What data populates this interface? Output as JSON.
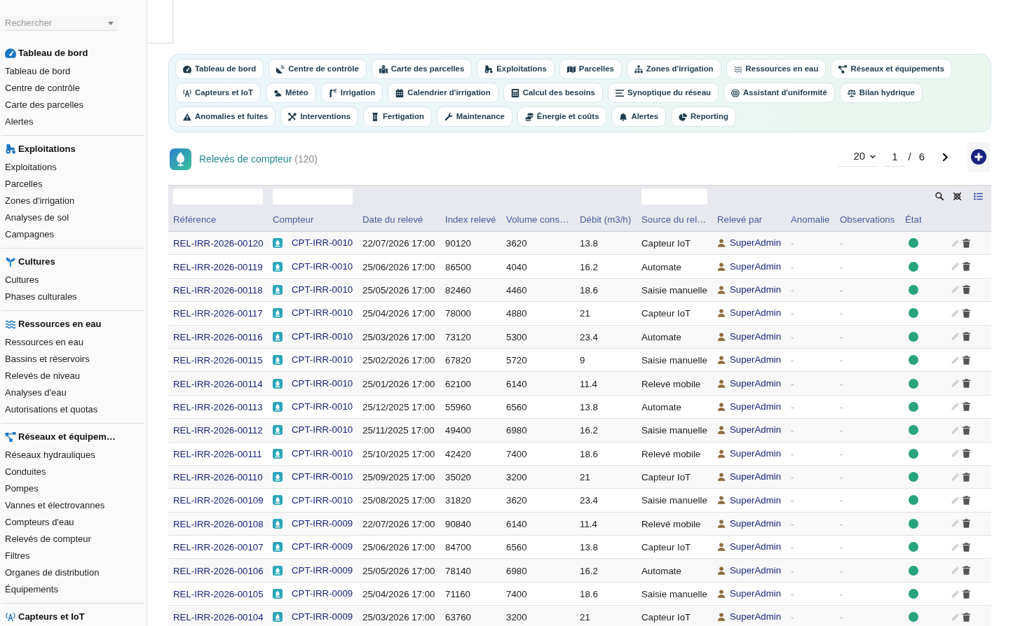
{
  "sidebar": {
    "search": {
      "placeholder": "Rechercher"
    },
    "sections": [
      {
        "title": "Tableau de bord",
        "items": [
          {
            "label": "Tableau de bord"
          },
          {
            "label": "Centre de contrôle"
          },
          {
            "label": "Carte des parcelles"
          },
          {
            "label": "Alertes"
          }
        ]
      },
      {
        "title": "Exploitations",
        "items": [
          {
            "label": "Exploitations"
          },
          {
            "label": "Parcelles"
          },
          {
            "label": "Zones d'irrigation"
          },
          {
            "label": "Analyses de sol"
          },
          {
            "label": "Campagnes"
          }
        ]
      },
      {
        "title": "Cultures",
        "items": [
          {
            "label": "Cultures"
          },
          {
            "label": "Phases culturales"
          }
        ]
      },
      {
        "title": "Ressources en eau",
        "items": [
          {
            "label": "Ressources en eau"
          },
          {
            "label": "Bassins et réservoirs"
          },
          {
            "label": "Relevés de niveau"
          },
          {
            "label": "Analyses d'eau"
          },
          {
            "label": "Autorisations et quotas"
          }
        ]
      },
      {
        "title": "Réseaux et équipem…",
        "items": [
          {
            "label": "Réseaux hydrauliques"
          },
          {
            "label": "Conduites"
          },
          {
            "label": "Pompes"
          },
          {
            "label": "Vannes et électrovannes"
          },
          {
            "label": "Compteurs d'eau"
          },
          {
            "label": "Relevés de compteur"
          },
          {
            "label": "Filtres"
          },
          {
            "label": "Organes de distribution"
          },
          {
            "label": "Équipements"
          }
        ]
      },
      {
        "title": "Capteurs et IoT"
      }
    ]
  },
  "quick_links": {
    "rows": [
      [
        {
          "label": "Tableau de bord"
        },
        {
          "label": "Centre de contrôle"
        },
        {
          "label": "Carte des parcelles"
        },
        {
          "label": "Exploitations"
        },
        {
          "label": "Parcelles"
        },
        {
          "label": "Zones d'irrigation"
        },
        {
          "label": "Ressources en eau"
        },
        {
          "label": "Réseaux et équipements"
        }
      ],
      [
        {
          "label": "Capteurs et IoT"
        },
        {
          "label": "Météo"
        },
        {
          "label": "Irrigation"
        },
        {
          "label": "Calendrier d'irrigation"
        },
        {
          "label": "Calcul des besoins"
        },
        {
          "label": "Synoptique du réseau"
        },
        {
          "label": "Assistant d'uniformité"
        },
        {
          "label": "Bilan hydrique"
        }
      ],
      [
        {
          "label": "Anomalies et fuites"
        },
        {
          "label": "Interventions"
        },
        {
          "label": "Fertigation"
        },
        {
          "label": "Maintenance"
        },
        {
          "label": "Énergie et coûts"
        },
        {
          "label": "Alertes"
        },
        {
          "label": "Reporting"
        }
      ]
    ]
  },
  "list": {
    "title": "Relevés de compteur",
    "count": "(120)",
    "pagination": {
      "page_size": "20",
      "page": "1",
      "separator": "/",
      "total_pages": "6"
    }
  },
  "table": {
    "columns": [
      {
        "label": "Référence",
        "filterable": true
      },
      {
        "label": "Compteur",
        "filterable": true
      },
      {
        "label": "Date du relevé",
        "filterable": false
      },
      {
        "label": "Index relevé",
        "filterable": false
      },
      {
        "label": "Volume cons…",
        "filterable": false
      },
      {
        "label": "Débit (m3/h)",
        "filterable": false
      },
      {
        "label": "Source du rel…",
        "filterable": true
      },
      {
        "label": "Relevé par",
        "filterable": false
      },
      {
        "label": "Anomalie",
        "filterable": false
      },
      {
        "label": "Observations",
        "filterable": false
      },
      {
        "label": "État",
        "filterable": false
      }
    ],
    "rows": [
      {
        "reference": "REL-IRR-2026-00120",
        "meter": "CPT-IRR-0010",
        "date": "22/07/2026 17:00",
        "index": "90120",
        "volume": "3620",
        "flow": "13.8",
        "source": "Capteur IoT",
        "read_by": "SuperAdmin",
        "anomaly": "-",
        "observations": "-",
        "color": "#27a37d"
      },
      {
        "reference": "REL-IRR-2026-00119",
        "meter": "CPT-IRR-0010",
        "date": "25/06/2026 17:00",
        "index": "86500",
        "volume": "4040",
        "flow": "16.2",
        "source": "Automate",
        "read_by": "SuperAdmin",
        "anomaly": "-",
        "observations": "-",
        "color": "#27a37d"
      },
      {
        "reference": "REL-IRR-2026-00118",
        "meter": "CPT-IRR-0010",
        "date": "25/05/2026 17:00",
        "index": "82460",
        "volume": "4460",
        "flow": "18.6",
        "source": "Saisie manuelle",
        "read_by": "SuperAdmin",
        "anomaly": "-",
        "observations": "-",
        "color": "#27a37d"
      },
      {
        "reference": "REL-IRR-2026-00117",
        "meter": "CPT-IRR-0010",
        "date": "25/04/2026 17:00",
        "index": "78000",
        "volume": "4880",
        "flow": "21",
        "source": "Capteur IoT",
        "read_by": "SuperAdmin",
        "anomaly": "-",
        "observations": "-",
        "color": "#27a37d"
      },
      {
        "reference": "REL-IRR-2026-00116",
        "meter": "CPT-IRR-0010",
        "date": "25/03/2026 17:00",
        "index": "73120",
        "volume": "5300",
        "flow": "23.4",
        "source": "Automate",
        "read_by": "SuperAdmin",
        "anomaly": "-",
        "observations": "-",
        "color": "#27a37d"
      },
      {
        "reference": "REL-IRR-2026-00115",
        "meter": "CPT-IRR-0010",
        "date": "25/02/2026 17:00",
        "index": "67820",
        "volume": "5720",
        "flow": "9",
        "source": "Saisie manuelle",
        "read_by": "SuperAdmin",
        "anomaly": "-",
        "observations": "-",
        "color": "#27a37d"
      },
      {
        "reference": "REL-IRR-2026-00114",
        "meter": "CPT-IRR-0010",
        "date": "25/01/2026 17:00",
        "index": "62100",
        "volume": "6140",
        "flow": "11.4",
        "source": "Relevé mobile",
        "read_by": "SuperAdmin",
        "anomaly": "-",
        "observations": "-",
        "color": "#27a37d"
      },
      {
        "reference": "REL-IRR-2026-00113",
        "meter": "CPT-IRR-0010",
        "date": "25/12/2025 17:00",
        "index": "55960",
        "volume": "6560",
        "flow": "13.8",
        "source": "Automate",
        "read_by": "SuperAdmin",
        "anomaly": "-",
        "observations": "-",
        "color": "#27a37d"
      },
      {
        "reference": "REL-IRR-2026-00112",
        "meter": "CPT-IRR-0010",
        "date": "25/11/2025 17:00",
        "index": "49400",
        "volume": "6980",
        "flow": "16.2",
        "source": "Saisie manuelle",
        "read_by": "SuperAdmin",
        "anomaly": "-",
        "observations": "-",
        "color": "#27a37d"
      },
      {
        "reference": "REL-IRR-2026-00111",
        "meter": "CPT-IRR-0010",
        "date": "25/10/2025 17:00",
        "index": "42420",
        "volume": "7400",
        "flow": "18.6",
        "source": "Relevé mobile",
        "read_by": "SuperAdmin",
        "anomaly": "-",
        "observations": "-",
        "color": "#27a37d"
      },
      {
        "reference": "REL-IRR-2026-00110",
        "meter": "CPT-IRR-0010",
        "date": "25/09/2025 17:00",
        "index": "35020",
        "volume": "3200",
        "flow": "21",
        "source": "Capteur IoT",
        "read_by": "SuperAdmin",
        "anomaly": "-",
        "observations": "-",
        "color": "#27a37d"
      },
      {
        "reference": "REL-IRR-2026-00109",
        "meter": "CPT-IRR-0010",
        "date": "25/08/2025 17:00",
        "index": "31820",
        "volume": "3620",
        "flow": "23.4",
        "source": "Saisie manuelle",
        "read_by": "SuperAdmin",
        "anomaly": "-",
        "observations": "-",
        "color": "#27a37d"
      },
      {
        "reference": "REL-IRR-2026-00108",
        "meter": "CPT-IRR-0009",
        "date": "22/07/2026 17:00",
        "index": "90840",
        "volume": "6140",
        "flow": "11.4",
        "source": "Relevé mobile",
        "read_by": "SuperAdmin",
        "anomaly": "-",
        "observations": "-",
        "color": "#27a37d"
      },
      {
        "reference": "REL-IRR-2026-00107",
        "meter": "CPT-IRR-0009",
        "date": "25/06/2026 17:00",
        "index": "84700",
        "volume": "6560",
        "flow": "13.8",
        "source": "Capteur IoT",
        "read_by": "SuperAdmin",
        "anomaly": "-",
        "observations": "-",
        "color": "#27a37d"
      },
      {
        "reference": "REL-IRR-2026-00106",
        "meter": "CPT-IRR-0009",
        "date": "25/05/2026 17:00",
        "index": "78140",
        "volume": "6980",
        "flow": "16.2",
        "source": "Automate",
        "read_by": "SuperAdmin",
        "anomaly": "-",
        "observations": "-",
        "color": "#27a37d"
      },
      {
        "reference": "REL-IRR-2026-00105",
        "meter": "CPT-IRR-0009",
        "date": "25/04/2026 17:00",
        "index": "71160",
        "volume": "7400",
        "flow": "18.6",
        "source": "Saisie manuelle",
        "read_by": "SuperAdmin",
        "anomaly": "-",
        "observations": "-",
        "color": "#27a37d"
      },
      {
        "reference": "REL-IRR-2026-00104",
        "meter": "CPT-IRR-0009",
        "date": "25/03/2026 17:00",
        "index": "63760",
        "volume": "3200",
        "flow": "21",
        "source": "Capteur IoT",
        "read_by": "SuperAdmin",
        "anomaly": "-",
        "observations": "-",
        "color": "#27a37d"
      }
    ]
  }
}
